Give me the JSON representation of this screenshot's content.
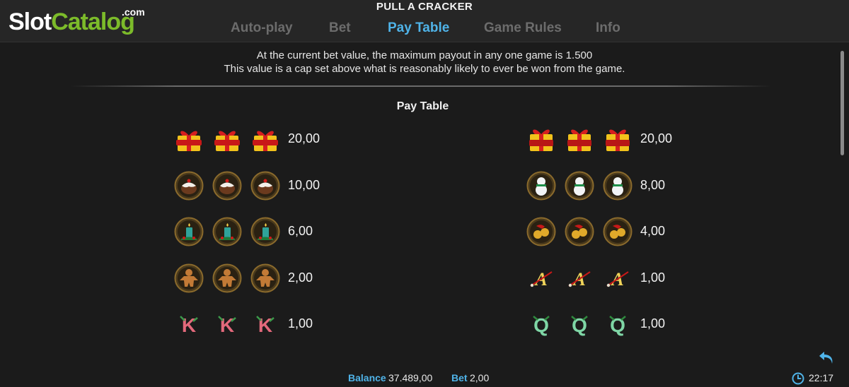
{
  "header": {
    "title": "PULL A CRACKER",
    "logo": {
      "part1": "Slot",
      "part2": "Catalog",
      "dotcom": ".com"
    },
    "tabs": [
      {
        "label": "Auto-play",
        "active": false
      },
      {
        "label": "Bet",
        "active": false
      },
      {
        "label": "Pay Table",
        "active": true
      },
      {
        "label": "Game Rules",
        "active": false
      },
      {
        "label": "Info",
        "active": false
      }
    ]
  },
  "notice": {
    "line1": "At the current bet value, the maximum payout in any one game is 1.500",
    "line2": "This value is a cap set above what is reasonably likely to ever be won from the game."
  },
  "paytable": {
    "title": "Pay Table",
    "left": [
      {
        "symbol": "jackpot-gift-icon",
        "payout": "20,00"
      },
      {
        "symbol": "christmas-pudding-icon",
        "payout": "10,00"
      },
      {
        "symbol": "candle-icon",
        "payout": "6,00"
      },
      {
        "symbol": "gingerbread-man-icon",
        "payout": "2,00"
      },
      {
        "symbol": "letter-k-icon",
        "payout": "1,00"
      }
    ],
    "right": [
      {
        "symbol": "wild-gift-icon",
        "payout": "20,00"
      },
      {
        "symbol": "snowman-icon",
        "payout": "8,00"
      },
      {
        "symbol": "jingle-bells-icon",
        "payout": "4,00"
      },
      {
        "symbol": "letter-a-icon",
        "payout": "1,00"
      },
      {
        "symbol": "letter-q-icon",
        "payout": "1,00"
      }
    ]
  },
  "footer": {
    "balance_label": "Balance",
    "balance_value": "37.489,00",
    "bet_label": "Bet",
    "bet_value": "2,00",
    "time": "22:17"
  },
  "colors": {
    "accent": "#4fb3e8",
    "background": "#1b1b1b",
    "bar": "#262626",
    "tab_inactive": "#6c6c6c",
    "logo_green": "#7cbb2a"
  }
}
